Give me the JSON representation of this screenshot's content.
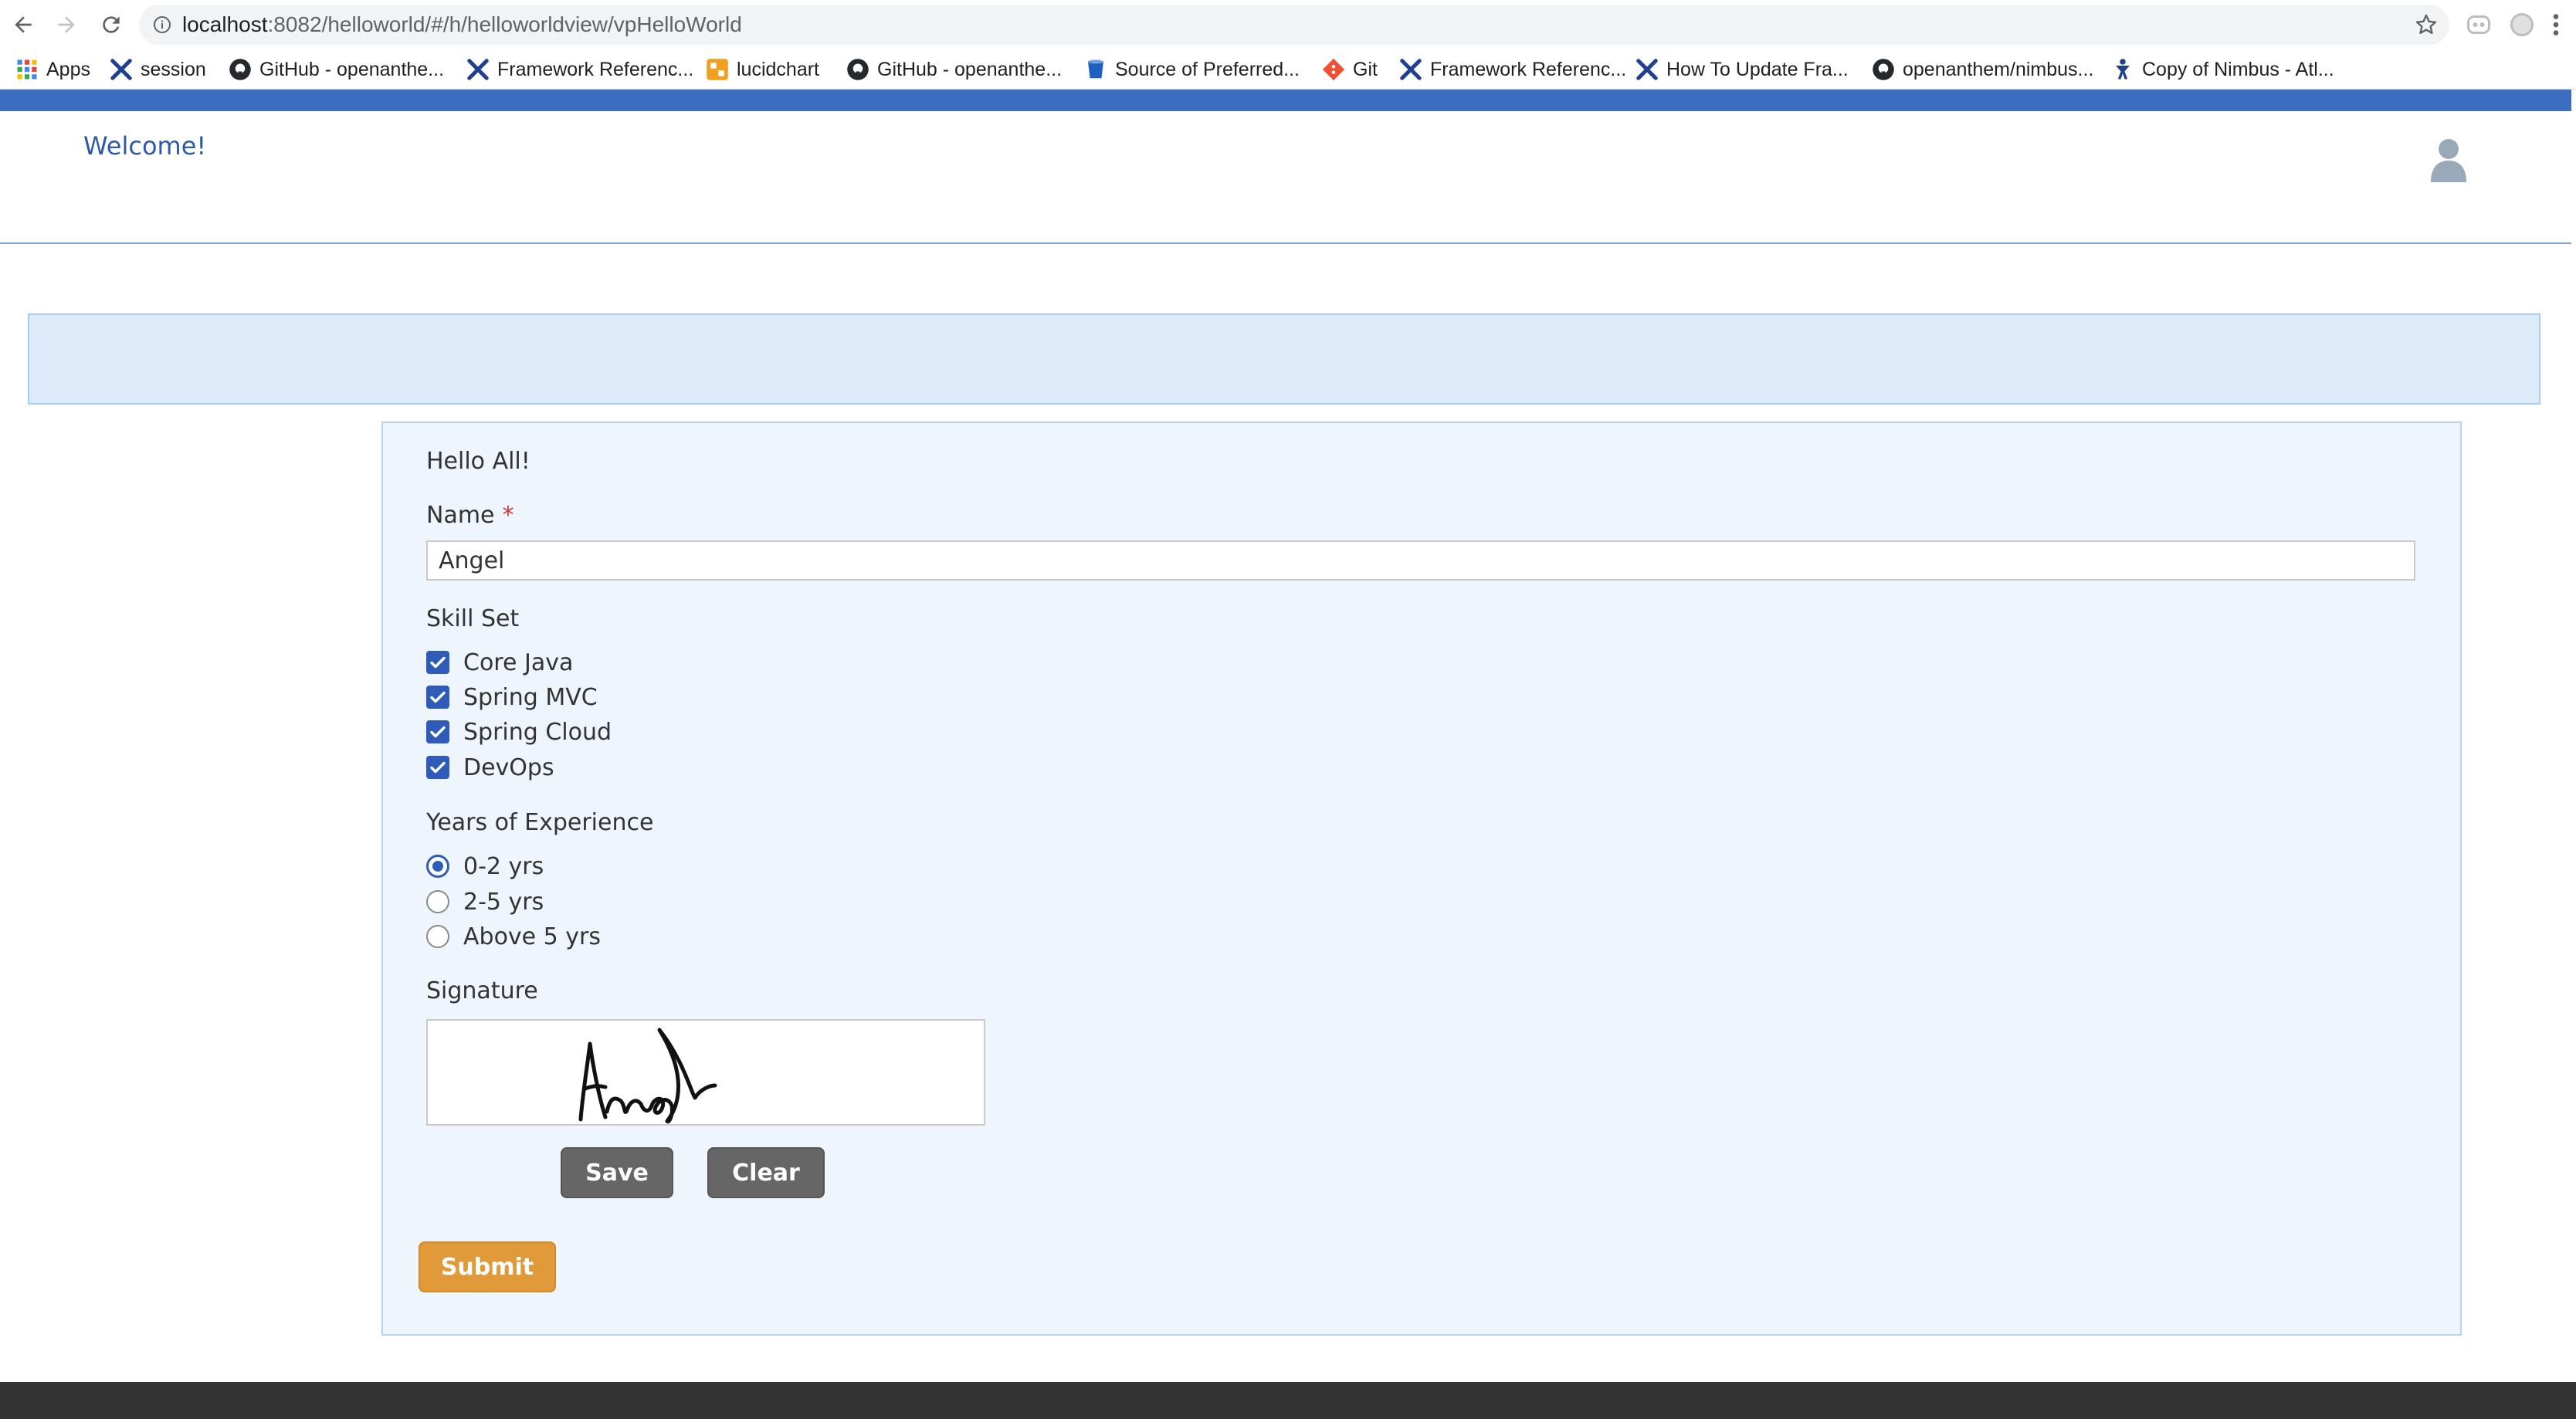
{
  "browser": {
    "url_host": "localhost",
    "url_rest": ":8082/helloworld/#/h/helloworldview/vpHelloWorld",
    "bookmarks": [
      {
        "label": "Apps",
        "icon": "apps-grid-icon"
      },
      {
        "label": "session",
        "icon": "framework-x-icon"
      },
      {
        "label": "GitHub - openanthe...",
        "icon": "github-icon"
      },
      {
        "label": "Framework Referenc...",
        "icon": "framework-x-icon"
      },
      {
        "label": "lucidchart",
        "icon": "lucidchart-icon"
      },
      {
        "label": "GitHub - openanthe...",
        "icon": "github-icon"
      },
      {
        "label": "Source of Preferred...",
        "icon": "bucket-icon"
      },
      {
        "label": "Git",
        "icon": "git-icon"
      },
      {
        "label": "Framework Referenc...",
        "icon": "framework-x-icon"
      },
      {
        "label": "How To Update Fra...",
        "icon": "framework-x-icon"
      },
      {
        "label": "openanthem/nimbus...",
        "icon": "github-icon"
      },
      {
        "label": "Copy of Nimbus - Atl...",
        "icon": "atlassian-icon"
      }
    ]
  },
  "header": {
    "welcome": "Welcome!"
  },
  "form": {
    "greeting": "Hello All!",
    "name": {
      "label": "Name",
      "required_mark": "*",
      "value": "Angel"
    },
    "skills": {
      "label": "Skill Set",
      "options": [
        {
          "label": "Core Java",
          "checked": true
        },
        {
          "label": "Spring MVC",
          "checked": true
        },
        {
          "label": "Spring Cloud",
          "checked": true
        },
        {
          "label": "DevOps",
          "checked": true
        }
      ]
    },
    "experience": {
      "label": "Years of Experience",
      "options": [
        {
          "label": "0-2 yrs",
          "selected": true
        },
        {
          "label": "2-5 yrs",
          "selected": false
        },
        {
          "label": "Above 5 yrs",
          "selected": false
        }
      ]
    },
    "signature": {
      "label": "Signature",
      "save_label": "Save",
      "clear_label": "Clear"
    },
    "submit_label": "Submit"
  },
  "colors": {
    "top_bar": "#3c6dbf",
    "banner": "#dceafa",
    "panel": "#eef5fd",
    "check": "#2e5cb8",
    "submit": "#e09a3a",
    "grey_button": "#666666"
  }
}
